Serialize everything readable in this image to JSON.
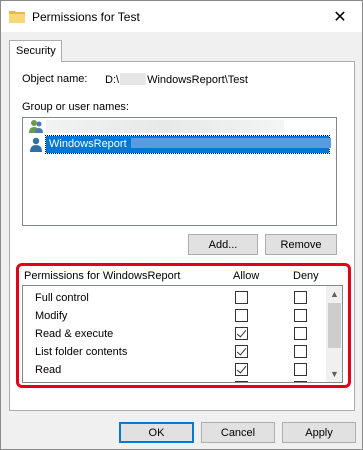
{
  "window": {
    "title": "Permissions for Test",
    "close_glyph": "✕"
  },
  "tabs": [
    {
      "label": "Security"
    }
  ],
  "object": {
    "label": "Object name:",
    "prefix": "D:\\",
    "suffix": "WindowsReport\\Test"
  },
  "group": {
    "label": "Group or user names:",
    "users": [
      {
        "name": "",
        "selected": false
      },
      {
        "name": "WindowsReport",
        "selected": true
      }
    ]
  },
  "buttons": {
    "add": "Add...",
    "remove": "Remove",
    "ok": "OK",
    "cancel": "Cancel",
    "apply": "Apply"
  },
  "permissions": {
    "header": "Permissions for WindowsReport",
    "allow_label": "Allow",
    "deny_label": "Deny",
    "rows": [
      {
        "name": "Full control",
        "allow": false,
        "deny": false
      },
      {
        "name": "Modify",
        "allow": false,
        "deny": false
      },
      {
        "name": "Read & execute",
        "allow": true,
        "deny": false
      },
      {
        "name": "List folder contents",
        "allow": true,
        "deny": false
      },
      {
        "name": "Read",
        "allow": true,
        "deny": false
      },
      {
        "name": "",
        "allow": false,
        "deny": false
      }
    ]
  },
  "colors": {
    "highlight": "#e3001b",
    "selection": "#0078d7"
  }
}
